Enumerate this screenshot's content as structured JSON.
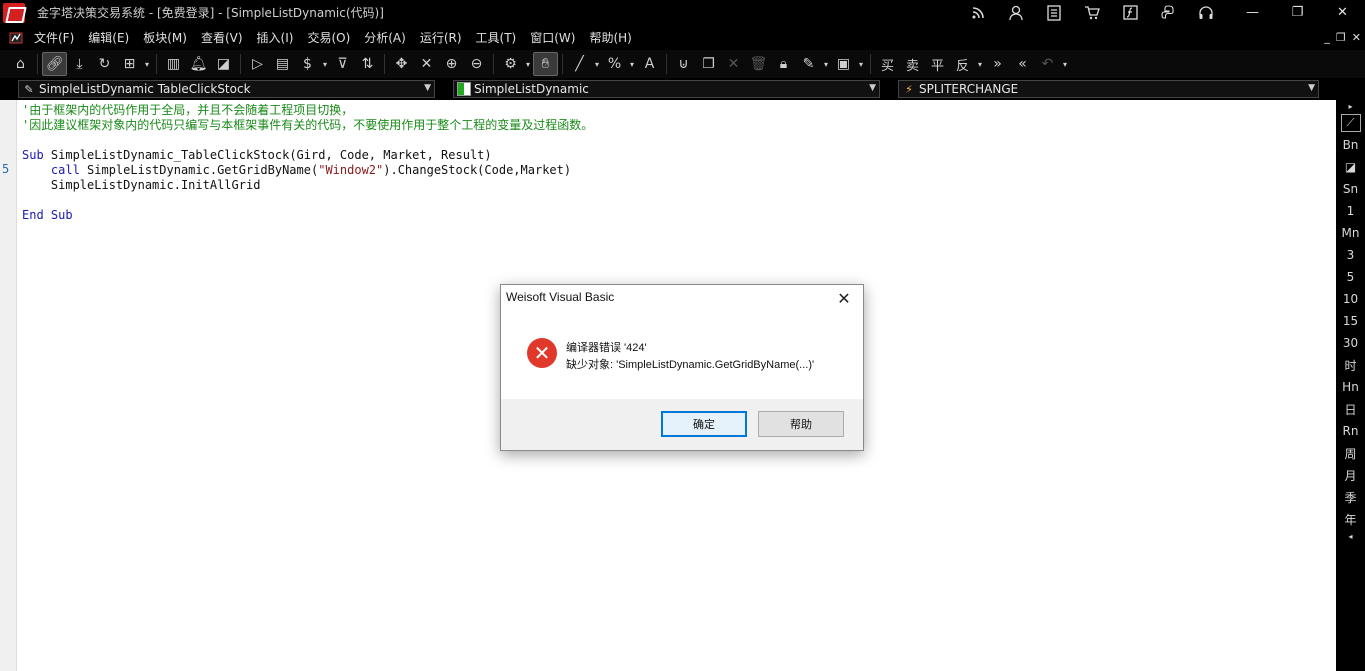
{
  "window": {
    "title": "金字塔决策交易系统 - [免费登录] - [SimpleListDynamic(代码)]"
  },
  "menu": {
    "items": [
      "文件(F)",
      "编辑(E)",
      "板块(M)",
      "查看(V)",
      "插入(I)",
      "交易(O)",
      "分析(A)",
      "运行(R)",
      "工具(T)",
      "窗口(W)",
      "帮助(H)"
    ]
  },
  "toolbar": {
    "trade_buttons": [
      "买",
      "卖",
      "平",
      "反"
    ]
  },
  "combos": {
    "procedure": "SimpleListDynamic TableClickStock",
    "object": "SimpleListDynamic",
    "event": "SPLITERCHANGE"
  },
  "editor": {
    "gutter_marker": "5",
    "lines": [
      {
        "kind": "comment",
        "text": "'由于框架内的代码作用于全局，并且不会随着工程项目切换，"
      },
      {
        "kind": "comment",
        "text": "'因此建议框架对象内的代码只编写与本框架事件有关的代码，不要使用作用于整个工程的变量及过程函数。"
      },
      {
        "kind": "blank",
        "text": ""
      },
      {
        "kind": "sub",
        "kw": "Sub",
        "rest": " SimpleListDynamic_TableClickStock(Gird, Code, Market, Result)"
      },
      {
        "kind": "call",
        "kw": "    call",
        "pre": " SimpleListDynamic.GetGridByName(",
        "str": "\"Window2\"",
        "post": ").ChangeStock(Code,Market)"
      },
      {
        "kind": "plain",
        "text": "    SimpleListDynamic.InitAllGrid"
      },
      {
        "kind": "blank",
        "text": ""
      },
      {
        "kind": "end",
        "kw": "End Sub"
      }
    ]
  },
  "rightbar": {
    "items": [
      "Bn",
      "Sn",
      "1",
      "Mn",
      "3",
      "5",
      "10",
      "15",
      "30",
      "时",
      "Hn",
      "日",
      "Rn",
      "周",
      "月",
      "季",
      "年"
    ]
  },
  "dialog": {
    "title": "Weisoft Visual Basic",
    "message_line1": "编译器错误 '424'",
    "message_line2": "缺少对象: 'SimpleListDynamic.GetGridByName(...)'",
    "ok_label": "确定",
    "help_label": "帮助"
  }
}
